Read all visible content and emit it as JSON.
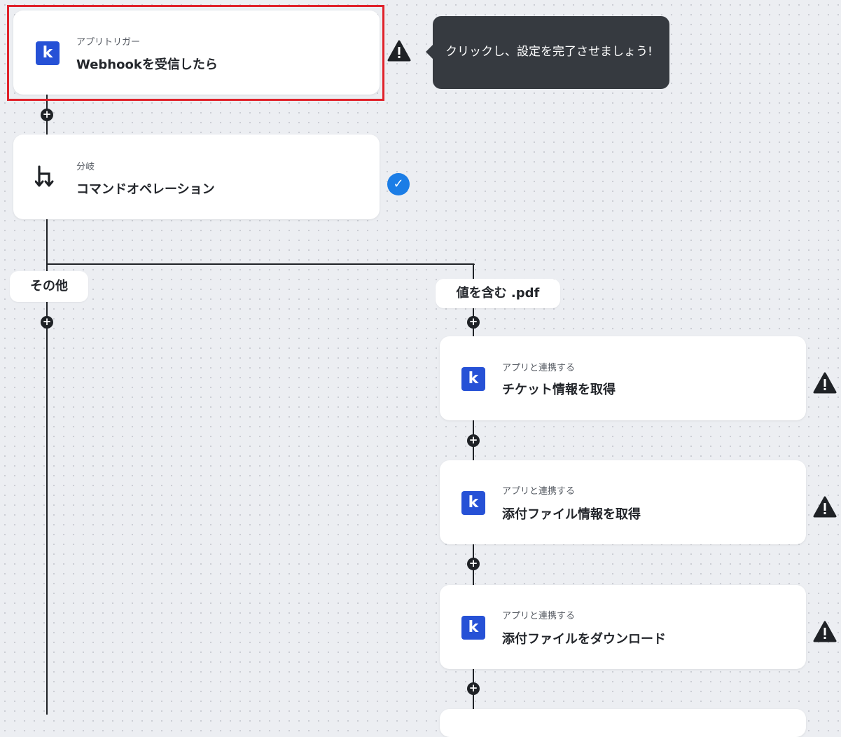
{
  "trigger": {
    "subtitle": "アプリトリガー",
    "title": "Webhookを受信したら",
    "icon": "k",
    "warning_icon": "warning-icon"
  },
  "tooltip": {
    "text": "クリックし、設定を完了させましょう!"
  },
  "branch": {
    "subtitle": "分岐",
    "title": "コマンドオペレーション",
    "icon": "branch-icon",
    "status_icon": "check-icon"
  },
  "branches": {
    "other_label": "その他",
    "pdf_label": "値を含む .pdf"
  },
  "steps": [
    {
      "subtitle": "アプリと連携する",
      "title": "チケット情報を取得",
      "icon": "k"
    },
    {
      "subtitle": "アプリと連携する",
      "title": "添付ファイル情報を取得",
      "icon": "k"
    },
    {
      "subtitle": "アプリと連携する",
      "title": "添付ファイルをダウンロード",
      "icon": "k"
    }
  ],
  "colors": {
    "accent": "#2651d6",
    "highlight": "#e0212a",
    "check": "#1b7de6",
    "tooltip_bg": "#363a40"
  }
}
